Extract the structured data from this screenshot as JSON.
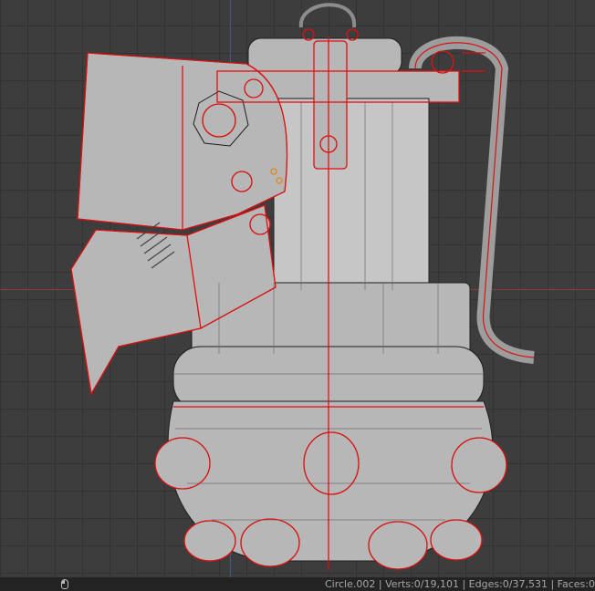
{
  "viewport": {
    "axis_x_color": "#8a3a3a",
    "axis_y_color": "#3c5f86",
    "selection_color": "#e01010",
    "mesh_color": "#b9b9b9"
  },
  "statusbar": {
    "mouse_icon": "mouse-icon",
    "stats_text": "Circle.002 | Verts:0/19,101 | Edges:0/37,531 | Faces:0"
  }
}
